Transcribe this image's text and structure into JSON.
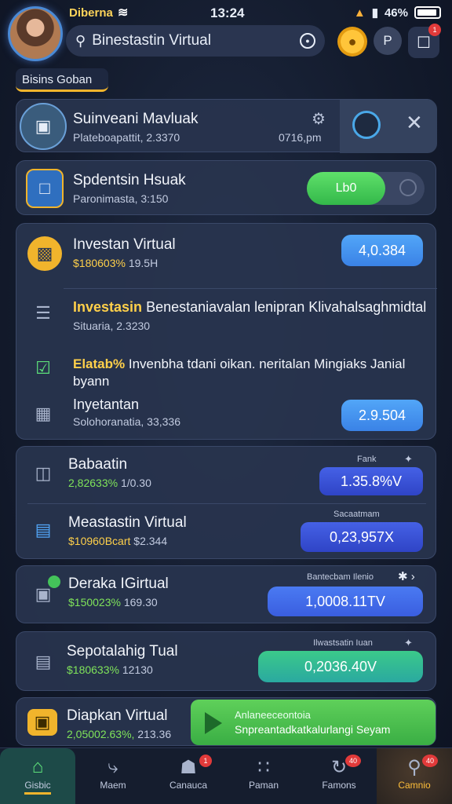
{
  "status": {
    "carrier": "Diberna",
    "time": "13:24",
    "battery": "46%"
  },
  "search": {
    "label": "Binestastin Virtual"
  },
  "buttons": {
    "p": "P",
    "bell_badge": "1"
  },
  "section": "Bisins Goban",
  "card1": {
    "title": "Suinveani Mavluak",
    "sub": "Plateboapattit, 2.3370",
    "time": "0716,pm"
  },
  "card2": {
    "title": "Spdentsin Hsuak",
    "sub": "Paronimasta, 3:150",
    "toggle": "Lb0"
  },
  "list": [
    {
      "title": "Investan Virtual",
      "sub": "$180603%",
      "sub2": "19.5H",
      "value": "4,0.384"
    },
    {
      "title_hl": "Investasin",
      "title_rest": "Benestaniavalan lenipran Klivahalsaghmidtal",
      "sub": "Situaria, 2.3230"
    },
    {
      "title_hl": "Elatab%",
      "title_rest": "Invenbha tdani oikan. neritalan Mingiaks Janial byann"
    },
    {
      "title": "Inyetantan",
      "sub": "Solohoranatia, 33,336",
      "value": "2.9.504"
    }
  ],
  "group2": [
    {
      "title": "Babaatin",
      "sub": "2,82633%",
      "sub2": "1/0.30",
      "label": "Fank",
      "value": "1.35.8%V"
    },
    {
      "title": "Meastastin Virtual",
      "sub": "$10960Bcart",
      "sub2": "$2.344",
      "label": "Sacaatmam",
      "value": "0,23,957X"
    }
  ],
  "card_deraka": {
    "title": "Deraka IGirtual",
    "sub": "$150023%",
    "sub2": "169.30",
    "label": "Bantecbam Ilenio",
    "value": "1,0008.11TV"
  },
  "card_sepot": {
    "title": "Sepotalahig Tual",
    "sub": "$180633%",
    "sub2": "12130",
    "label": "Ilwastsatin Iuan",
    "value": "0,2036.40V"
  },
  "card_diap": {
    "title": "Diapkan Virtual",
    "sub": "2,05002.63%,",
    "sub2": "213.36",
    "cta1": "Anlaneeceontoia",
    "cta2": "Snpreantadkatkalurlangi Seyam"
  },
  "nav": [
    {
      "label": "Gisbic",
      "badge": ""
    },
    {
      "label": "Maem",
      "badge": ""
    },
    {
      "label": "Canauca",
      "badge": "1"
    },
    {
      "label": "Paman",
      "badge": ""
    },
    {
      "label": "Famons",
      "badge": "40"
    },
    {
      "label": "Camnio",
      "badge": "40"
    }
  ],
  "colors": {
    "accent": "#f1b42c",
    "green": "#5de07a",
    "blue": "#3a82e6",
    "bg": "#141c2e"
  }
}
